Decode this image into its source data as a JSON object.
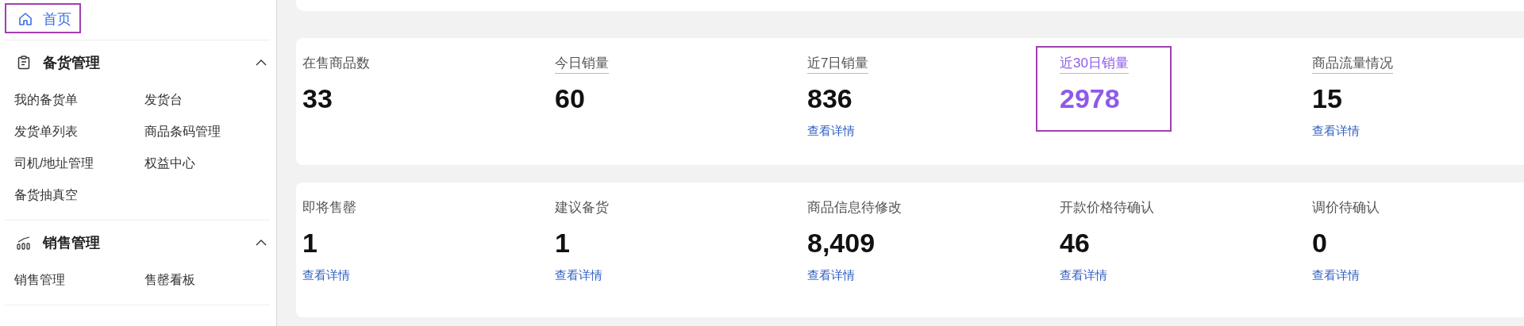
{
  "sidebar": {
    "home": {
      "label": "首页",
      "selected": true,
      "highlighted": true
    },
    "groups": [
      {
        "title": "备货管理",
        "kind": "clipboard",
        "expanded": true,
        "items": [
          "我的备货单",
          "发货台",
          "发货单列表",
          "商品条码管理",
          "司机/地址管理",
          "权益中心",
          "备货抽真空"
        ]
      },
      {
        "title": "销售管理",
        "kind": "chart",
        "expanded": true,
        "items": [
          "销售管理",
          "售罄看板"
        ]
      }
    ]
  },
  "stat_cards": [
    {
      "stats": [
        {
          "label": "在售商品数",
          "value": "33",
          "underlined": false,
          "highlighted": false
        },
        {
          "label": "今日销量",
          "value": "60",
          "underlined": true,
          "highlighted": false
        },
        {
          "label": "近7日销量",
          "value": "836",
          "underlined": true,
          "highlighted": false,
          "link": "查看详情"
        },
        {
          "label": "近30日销量",
          "value": "2978",
          "underlined": true,
          "highlighted": true
        },
        {
          "label": "商品流量情况",
          "value": "15",
          "underlined": true,
          "highlighted": false,
          "link": "查看详情"
        }
      ]
    },
    {
      "stats": [
        {
          "label": "即将售罄",
          "value": "1",
          "underlined": false,
          "highlighted": false,
          "link": "查看详情"
        },
        {
          "label": "建议备货",
          "value": "1",
          "underlined": false,
          "highlighted": false,
          "link": "查看详情"
        },
        {
          "label": "商品信息待修改",
          "value": "8,409",
          "underlined": false,
          "highlighted": false,
          "link": "查看详情"
        },
        {
          "label": "开款价格待确认",
          "value": "46",
          "underlined": false,
          "highlighted": false,
          "link": "查看详情"
        },
        {
          "label": "调价待确认",
          "value": "0",
          "underlined": false,
          "highlighted": false,
          "link": "查看详情"
        }
      ]
    }
  ]
}
